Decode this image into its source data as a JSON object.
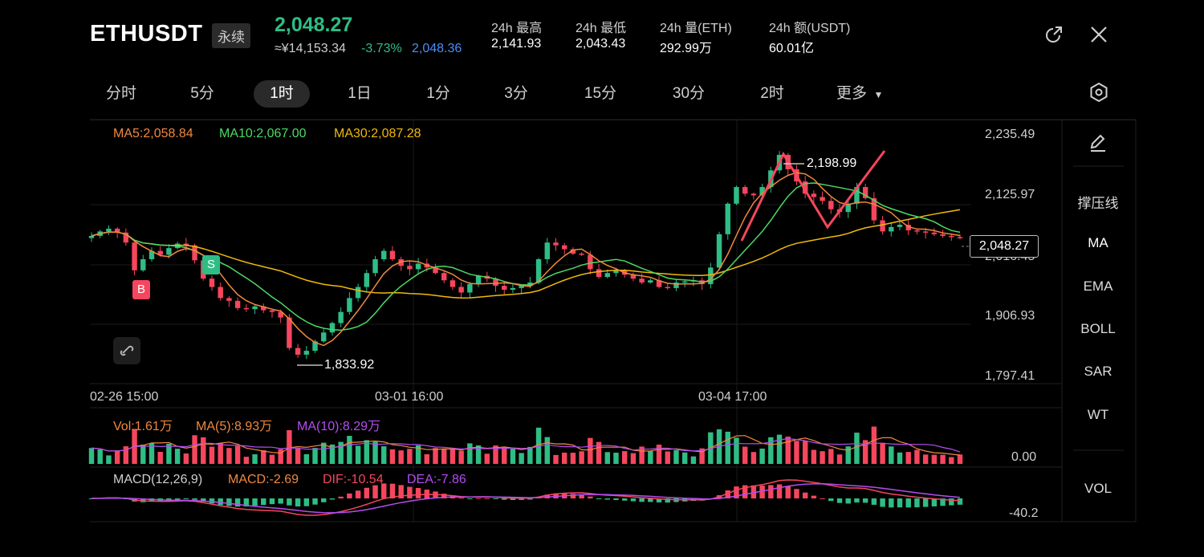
{
  "header": {
    "symbol": "ETHUSDT",
    "perp_tag": "永续",
    "last_price": "2,048.27",
    "cny_price": "≈¥14,153.34",
    "change_pct": "-3.73%",
    "mark_price": "2,048.36",
    "stats": [
      {
        "label": "24h  最高",
        "value": "2,141.93"
      },
      {
        "label": "24h  最低",
        "value": "2,043.43"
      },
      {
        "label": "24h  量(ETH)",
        "value": "292.99万"
      },
      {
        "label": "24h  额(USDT)",
        "value": "60.01亿"
      }
    ]
  },
  "intervals": [
    "分时",
    "5分",
    "1时",
    "1日",
    "1分",
    "3分",
    "15分",
    "30分",
    "2时",
    "更多"
  ],
  "active_interval": "1时",
  "indicators": {
    "ma5": "MA5:2,058.84",
    "ma10": "MA10:2,067.00",
    "ma30": "MA30:2,087.28",
    "vol": "Vol:1.61万",
    "vol_ma5": "MA(5):8.93万",
    "vol_ma10": "MA(10):8.29万",
    "macd_title": "MACD(12,26,9)",
    "macd": "MACD:-2.69",
    "dif": "DIF:-10.54",
    "dea": "DEA:-7.86"
  },
  "price_axis": [
    "2,235.49",
    "2,125.97",
    "2,016.45",
    "1,906.93",
    "1,797.41"
  ],
  "time_axis": [
    "02-26 15:00",
    "03-01 16:00",
    "03-04 17:00"
  ],
  "annotations": {
    "high": "2,198.99",
    "low": "1,833.92",
    "current": "2,048.27",
    "buy": "B",
    "sell": "S"
  },
  "vol_axis": "0.00",
  "macd_axis": "-40.2",
  "side_panel": [
    "撑压线",
    "MA",
    "EMA",
    "BOLL",
    "SAR",
    "WT",
    "VOL"
  ],
  "colors": {
    "up": "#2ebd85",
    "down": "#f6465d",
    "ma5": "#f0883e",
    "ma10": "#4cd964",
    "ma30": "#f0b90b",
    "macd_dea": "#b44df0",
    "mark": "#4c8ef5"
  },
  "chart_data": {
    "type": "candlestick",
    "y_range": [
      1797.41,
      2235.49
    ],
    "close": [
      2052,
      2060,
      2065,
      2058,
      2040,
      1990,
      2010,
      2025,
      2018,
      2030,
      2038,
      2035,
      2008,
      1975,
      1960,
      1940,
      1935,
      1922,
      1920,
      1925,
      1918,
      1915,
      1905,
      1850,
      1838,
      1845,
      1862,
      1878,
      1895,
      1915,
      1940,
      1960,
      1985,
      2010,
      2025,
      2010,
      1998,
      1992,
      2002,
      1995,
      1985,
      1972,
      1960,
      1950,
      1965,
      1980,
      1975,
      1962,
      1955,
      1958,
      1962,
      1968,
      2010,
      2040,
      2035,
      2028,
      2020,
      2018,
      1992,
      1978,
      1985,
      1990,
      1982,
      1975,
      1968,
      1972,
      1960,
      1958,
      1968,
      1970,
      1972,
      1965,
      1995,
      2055,
      2110,
      2140,
      2128,
      2125,
      2140,
      2170,
      2198,
      2172,
      2150,
      2128,
      2122,
      2115,
      2100,
      2095,
      2110,
      2140,
      2120,
      2080,
      2060,
      2068,
      2072,
      2062,
      2060,
      2058,
      2055,
      2052,
      2050,
      2048
    ]
  }
}
